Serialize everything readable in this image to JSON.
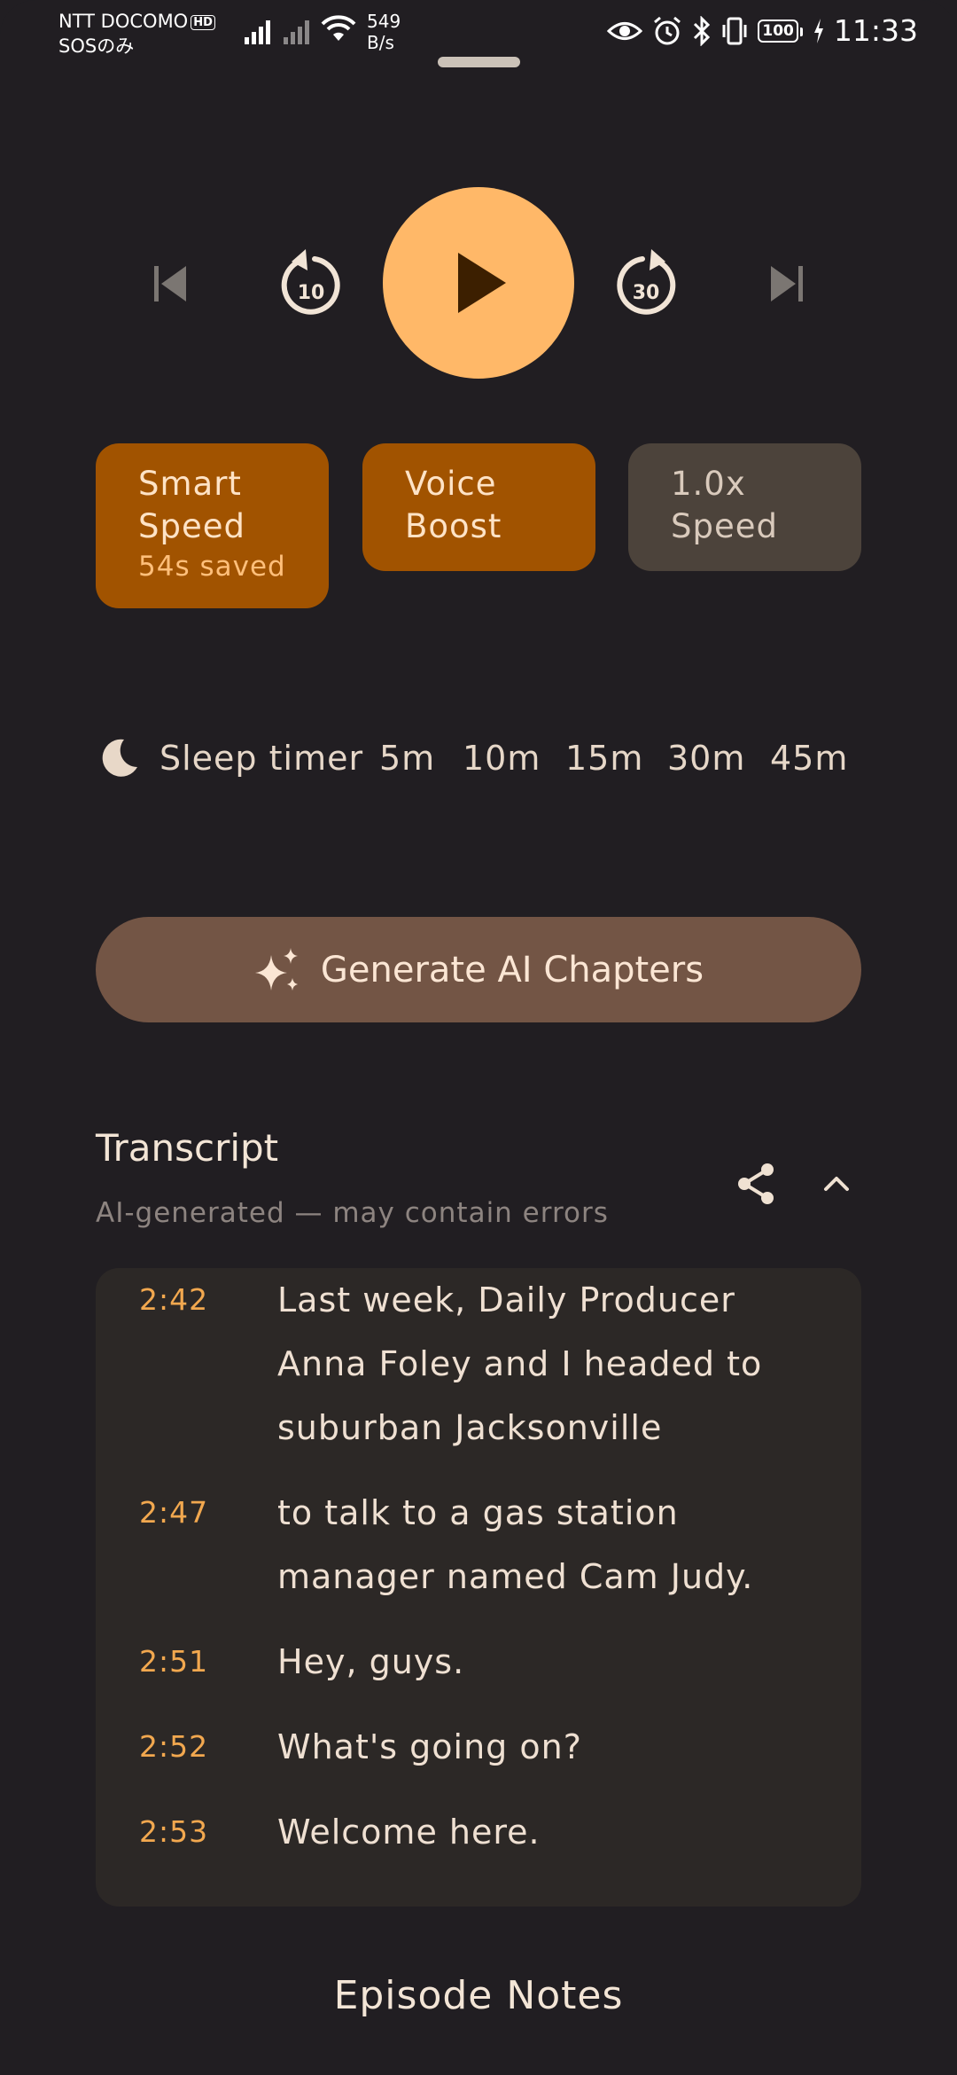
{
  "status_bar": {
    "carrier": "NTT DOCOMO",
    "hd": "HD",
    "carrier_sub": "SOSのみ",
    "net_speed_value": "549",
    "net_speed_unit": "B/s",
    "battery": "100",
    "time": "11:33"
  },
  "player": {
    "skip_back_seconds": "10",
    "skip_forward_seconds": "30",
    "play_color": "#ffb868"
  },
  "chips": {
    "smart_speed": {
      "line1": "Smart",
      "line2": "Speed",
      "sub": "54s saved"
    },
    "voice_boost": {
      "line1": "Voice",
      "line2": "Boost"
    },
    "playback_speed": {
      "line1": "1.0x",
      "line2": "Speed"
    }
  },
  "sleep_timer": {
    "label": "Sleep timer",
    "options": [
      "5m",
      "10m",
      "15m",
      "30m",
      "45m"
    ]
  },
  "ai_chapters": {
    "label": "Generate AI Chapters"
  },
  "transcript": {
    "title": "Transcript",
    "subtitle": "AI-generated — may contain errors",
    "lines": [
      {
        "time": "2:42",
        "text": "Last week, Daily Producer Anna Foley and I headed to suburban Jacksonville"
      },
      {
        "time": "2:47",
        "text": "to talk to a gas station manager named Cam Judy."
      },
      {
        "time": "2:51",
        "text": "Hey, guys."
      },
      {
        "time": "2:52",
        "text": "What's going on?"
      },
      {
        "time": "2:53",
        "text": "Welcome here."
      }
    ]
  },
  "episode_notes": {
    "title": "Episode Notes"
  },
  "colors": {
    "accent": "#ffb868",
    "chip_active": "#a15300",
    "background": "#211e22"
  }
}
